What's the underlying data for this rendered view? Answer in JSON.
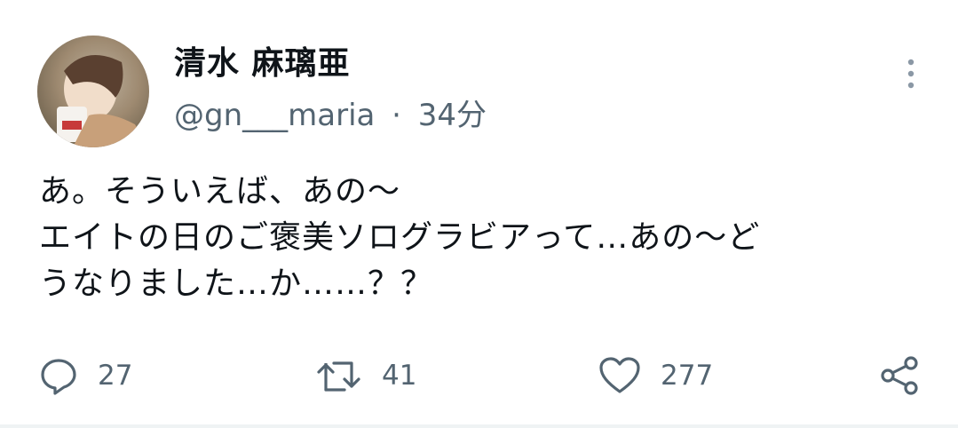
{
  "tweet": {
    "author_name": "清水 麻璃亜",
    "handle": "@gn___maria",
    "separator": "·",
    "time": "34分",
    "text": "あ。そういえば、あの〜\nエイトの日のご褒美ソログラビアって…あの〜ど\nうなりました…か……？？"
  },
  "actions": {
    "reply_count": "27",
    "retweet_count": "41",
    "like_count": "277"
  },
  "icons": {
    "more": "more-vertical-icon",
    "reply": "reply-icon",
    "retweet": "retweet-icon",
    "like": "heart-icon",
    "share": "share-icon"
  },
  "colors": {
    "text_primary": "#0f1419",
    "text_secondary": "#536471",
    "divider": "#eff3f4"
  }
}
